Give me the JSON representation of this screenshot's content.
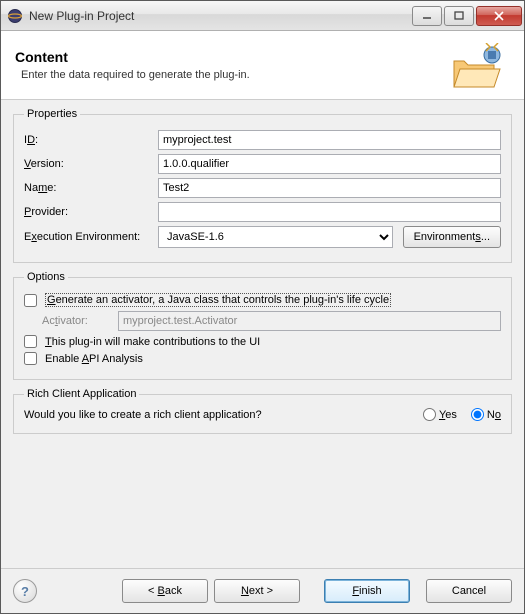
{
  "window": {
    "title": "New Plug-in Project"
  },
  "header": {
    "title": "Content",
    "description": "Enter the data required to generate the plug-in."
  },
  "properties": {
    "legend": "Properties",
    "id_label_pre": "I",
    "id_label_u": "D",
    "id_label_post": ":",
    "id_value": "myproject.test",
    "version_label_u": "V",
    "version_label_post": "ersion:",
    "version_value": "1.0.0.qualifier",
    "name_label_pre": "Na",
    "name_label_u": "m",
    "name_label_post": "e:",
    "name_value": "Test2",
    "provider_label_u": "P",
    "provider_label_post": "rovider:",
    "provider_value": "",
    "exec_env_pre": "E",
    "exec_env_u": "x",
    "exec_env_post": "ecution Environment:",
    "exec_env_value": "JavaSE-1.6",
    "environments_btn_pre": "Environment",
    "environments_btn_u": "s",
    "environments_btn_post": "..."
  },
  "options": {
    "legend": "Options",
    "generate_activator_u": "G",
    "generate_activator_post": "enerate an activator, a Java class that controls the plug-in's life cycle",
    "generate_activator_checked": false,
    "activator_label_pre": "Ac",
    "activator_label_u": "t",
    "activator_label_post": "ivator:",
    "activator_value": "myproject.test.Activator",
    "ui_contrib_u": "T",
    "ui_contrib_post": "his plug-in will make contributions to the UI",
    "ui_contrib_checked": false,
    "api_analysis_pre": "Enable ",
    "api_analysis_u": "A",
    "api_analysis_post": "PI Analysis",
    "api_analysis_checked": false
  },
  "rca": {
    "legend": "Rich Client Application",
    "question": "Would you like to create a rich client application?",
    "yes_u": "Y",
    "yes_post": "es",
    "no_pre": "N",
    "no_u": "o",
    "selected": "no"
  },
  "footer": {
    "help": "?",
    "back_pre": "< ",
    "back_u": "B",
    "back_post": "ack",
    "next_u": "N",
    "next_post": "ext >",
    "finish_u": "F",
    "finish_post": "inish",
    "cancel": "Cancel"
  }
}
